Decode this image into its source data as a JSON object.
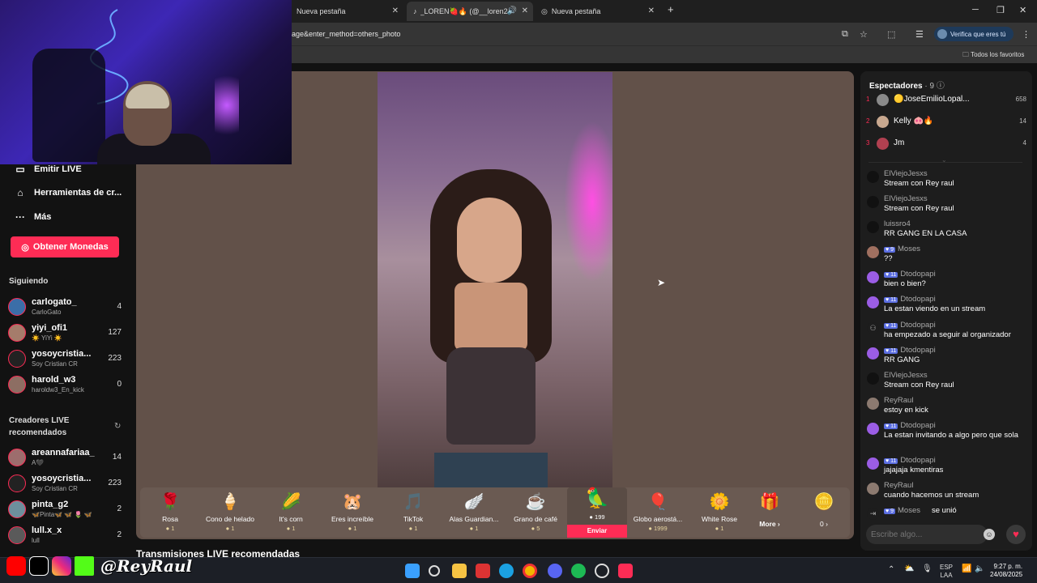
{
  "browser": {
    "tabs": [
      {
        "title": "Nueva pestaña",
        "active": false
      },
      {
        "title": "_LOREN🍓🔥 (@__loren2 I",
        "active": true
      },
      {
        "title": "Nueva pestaña",
        "active": false
      }
    ],
    "new_tab": "+",
    "url": "age&enter_method=others_photo",
    "verify_label": "Verifica que eres tú",
    "favorites_label": "Todos los favoritos"
  },
  "sidebar": {
    "nav": [
      {
        "label": "Emitir LIVE",
        "icon": "camera-icon"
      },
      {
        "label": "Herramientas de cr...",
        "icon": "creator-tools-icon"
      },
      {
        "label": "Más",
        "icon": "more-icon"
      }
    ],
    "coins_button": "Obtener Monedas",
    "following_title": "Siguiendo",
    "following": [
      {
        "name": "carlogato_",
        "sub": "CarloGato",
        "count": "4"
      },
      {
        "name": "yiyi_ofi1",
        "sub": "☀️ YiYi ☀️",
        "count": "127"
      },
      {
        "name": "yosoycristia...",
        "sub": "Soy Cristian CR",
        "count": "223"
      },
      {
        "name": "harold_w3",
        "sub": "haroldw3_En_kick",
        "count": "0"
      }
    ],
    "recommended_title": "Creadores LIVE recomendados",
    "recommended": [
      {
        "name": "areannafariaa_",
        "sub": "A🖤",
        "count": "14"
      },
      {
        "name": "yosoycristia...",
        "sub": "Soy Cristian CR",
        "count": "223"
      },
      {
        "name": "pinta_g2",
        "sub": "🦋Pinta🦋 🦋 🌷 🦋",
        "count": "2"
      },
      {
        "name": "lull.x_x",
        "sub": "lull",
        "count": "2"
      }
    ]
  },
  "recommended_streams_title": "Transmisiones LIVE recomendadas",
  "gifts": [
    {
      "name": "Rosa",
      "price": "1",
      "icon": "🌹"
    },
    {
      "name": "Cono de helado",
      "price": "1",
      "icon": "🍦"
    },
    {
      "name": "It's corn",
      "price": "1",
      "icon": "🌽"
    },
    {
      "name": "Eres increíble",
      "price": "1",
      "icon": "🐹"
    },
    {
      "name": "TikTok",
      "price": "1",
      "icon": "🎵"
    },
    {
      "name": "Alas Guardian...",
      "price": "1",
      "icon": "🪽"
    },
    {
      "name": "Grano de café",
      "price": "5",
      "icon": "☕"
    },
    {
      "name": "",
      "price": "199",
      "icon": "🦜",
      "selected": true,
      "send_label": "Enviar"
    },
    {
      "name": "Globo aerostá...",
      "price": "1999",
      "icon": "🎈"
    },
    {
      "name": "White Rose",
      "price": "1",
      "icon": "🌼"
    },
    {
      "name": "More",
      "price": "",
      "icon": "🎁"
    },
    {
      "name": "",
      "price": "0",
      "icon": "🪙"
    }
  ],
  "chat": {
    "viewers_title": "Espectadores",
    "viewers_count": "· 9",
    "top": [
      {
        "rank": "1",
        "name": "🟡JoseEmilioLopal...",
        "score": "658"
      },
      {
        "rank": "2",
        "name": "Kelly 🐽🔥",
        "score": "14"
      },
      {
        "rank": "3",
        "name": "Jm",
        "score": "4"
      }
    ],
    "messages": [
      {
        "user": "ElViejoJesxs",
        "badge": "",
        "text": "Stream con Rey raul"
      },
      {
        "user": "ElViejoJesxs",
        "badge": "",
        "text": "Stream con Rey raul"
      },
      {
        "user": "luissro4",
        "badge": "",
        "text": "RR GANG EN LA CASA"
      },
      {
        "user": "Moses",
        "badge": "9",
        "text": "??"
      },
      {
        "user": "Dtodopapi",
        "badge": "11",
        "text": "bien o bien?"
      },
      {
        "user": "Dtodopapi",
        "badge": "11",
        "text": "La estan viendo en un stream"
      },
      {
        "user": "Dtodopapi",
        "badge": "11",
        "text": "ha empezado a seguir al organizador"
      },
      {
        "user": "Dtodopapi",
        "badge": "11",
        "text": "RR GANG"
      },
      {
        "user": "ElViejoJesxs",
        "badge": "",
        "text": "Stream con Rey raul"
      },
      {
        "user": "ReyRaul",
        "badge": "",
        "text": "estoy en kick"
      },
      {
        "user": "Dtodopapi",
        "badge": "11",
        "text": "La estan invitando a algo pero que sola"
      },
      {
        "user": "Dtodopapi",
        "badge": "11",
        "text": "jajajaja kmentiras"
      },
      {
        "user": "ReyRaul",
        "badge": "",
        "text": "cuando hacemos un stream"
      },
      {
        "user": "Moses",
        "badge": "9",
        "text": "se unió"
      }
    ],
    "input_placeholder": "Escribe algo..."
  },
  "watermark": "@ReyRaul",
  "taskbar": {
    "lang": "ESP",
    "lang_sub": "LAA",
    "time": "9:27 p. m.",
    "date": "24/08/2025"
  }
}
